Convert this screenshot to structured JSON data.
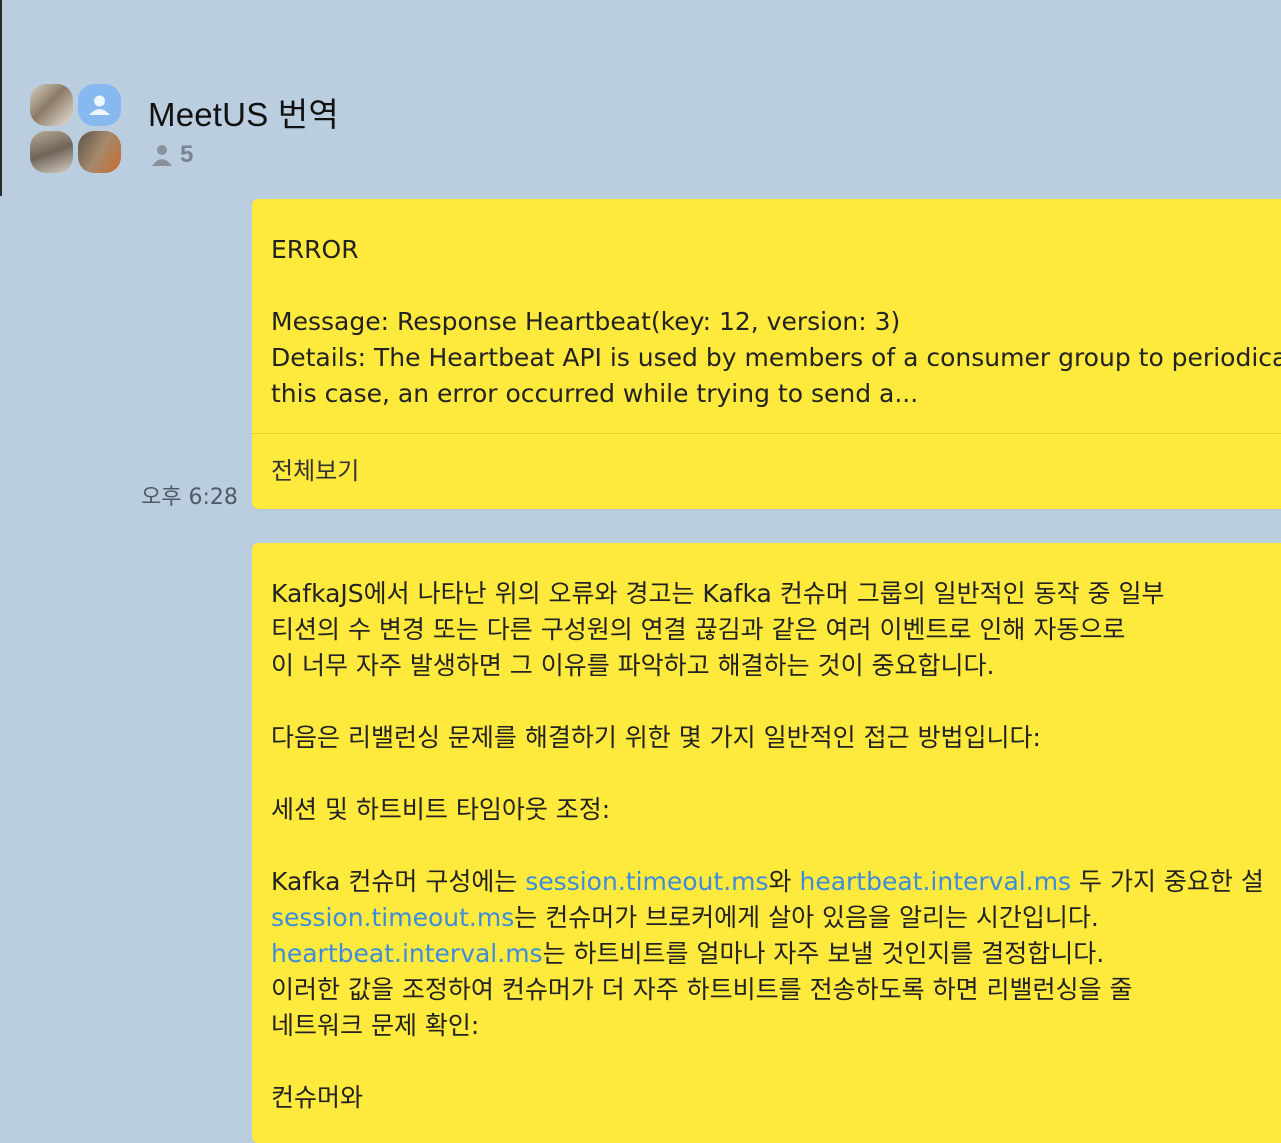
{
  "chat": {
    "title": "MeetUS 번역",
    "member_count": "5",
    "avatars": [
      "photo-avatar",
      "default-avatar",
      "photo-avatar",
      "photo-avatar"
    ]
  },
  "messages": [
    {
      "lines": [
        "ERROR",
        "",
        "Message: Response Heartbeat(key: 12, version: 3)",
        "Details: The Heartbeat API is used by members of a consumer group to periodicall",
        "this case, an error occurred while trying to send a..."
      ],
      "view_all": "전체보기",
      "time": "오후 6:28"
    },
    {
      "lines": [
        "KafkaJS에서 나타난 위의 오류와 경고는 Kafka 컨슈머 그룹의 일반적인 동작 중 일부",
        "티션의 수 변경 또는 다른 구성원의 연결 끊김과 같은 여러 이벤트로 인해 자동으로 ",
        "이 너무 자주 발생하면 그 이유를 파악하고 해결하는 것이 중요합니다.",
        "",
        "다음은 리밸런싱 문제를 해결하기 위한 몇 가지 일반적인 접근 방법입니다:",
        "",
        "세션 및 하트비트 타임아웃 조정:",
        ""
      ],
      "rich_lines": [
        {
          "parts": [
            "Kafka 컨슈머 구성에는 ",
            "session.timeout.ms",
            "와 ",
            "heartbeat.interval.ms",
            " 두 가지 중요한 설"
          ]
        },
        {
          "parts": [
            "session.timeout.ms",
            "는 컨슈머가 브로커에게 살아 있음을 알리는 시간입니다."
          ]
        },
        {
          "parts": [
            "heartbeat.interval.ms",
            "는 하트비트를 얼마나 자주 보낼 것인지를 결정합니다."
          ]
        }
      ],
      "tail_lines": [
        "이러한 값을 조정하여 컨슈머가 더 자주 하트비트를 전송하도록 하면 리밸런싱을 줄",
        "네트워크 문제 확인:",
        "",
        "컨슈머와"
      ]
    }
  ],
  "colors": {
    "background": "#bacee0",
    "bubble": "#fee93d",
    "link": "#3d8ddb"
  }
}
